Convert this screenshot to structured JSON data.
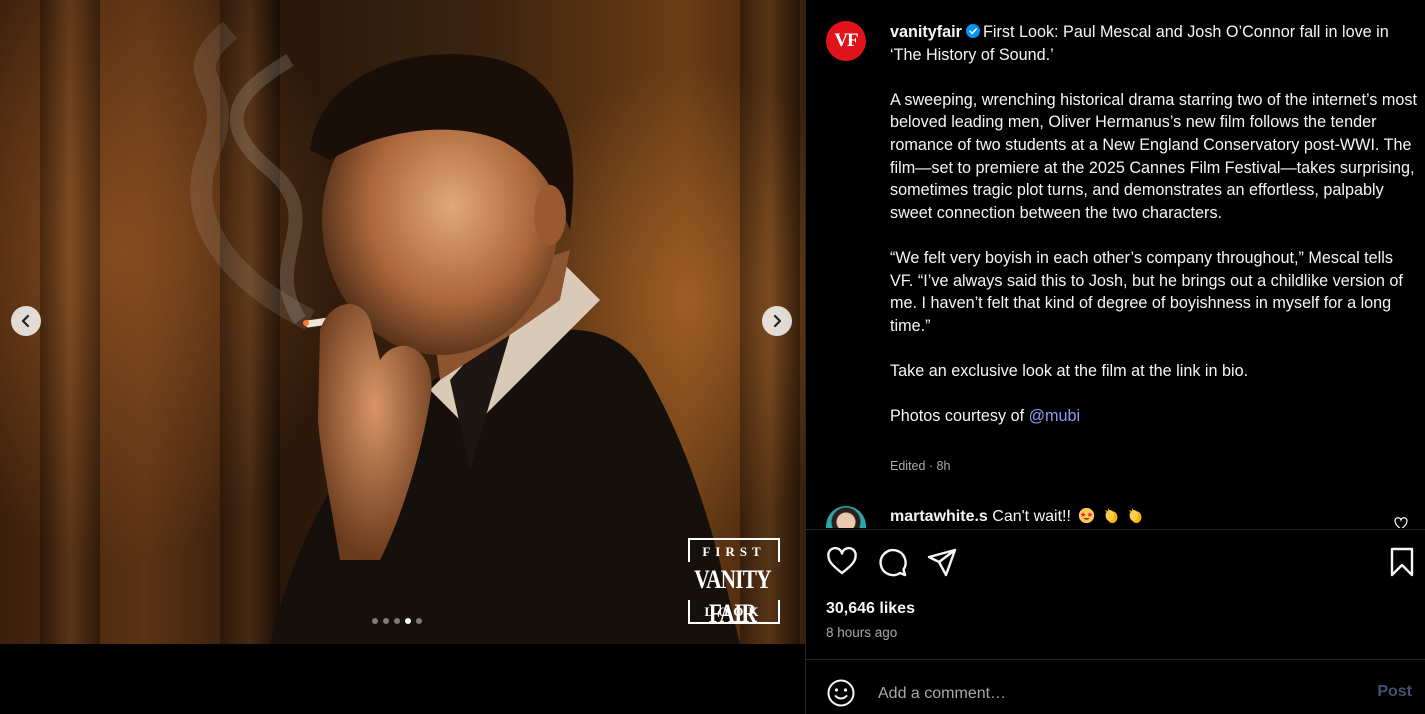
{
  "media": {
    "watermark": {
      "top": "FIRST",
      "middle": "VANITY FAIR",
      "bottom": "LOOK"
    },
    "carousel": {
      "total": 5,
      "active_index": 4
    },
    "prev_icon": "chevron-left-icon",
    "next_icon": "chevron-right-icon"
  },
  "post": {
    "avatar_text": "VF",
    "username": "vanityfair",
    "verified_icon": "verified-badge-icon",
    "caption_title": "First Look: Paul Mescal and Josh O’Connor fall in love in ‘The History of Sound.’",
    "caption_p1": "A sweeping, wrenching historical drama starring two of the internet’s most beloved leading men, Oliver Hermanus’s new film follows the tender romance of two students at a New England Conservatory post-WWI. The film—set to premiere at the 2025 Cannes Film Festival—takes surprising, sometimes tragic plot turns, and demonstrates an effortless, palpably sweet connection between the two characters.",
    "caption_p2": "“We felt very boyish in each other’s company throughout,” Mescal tells VF. “I’ve always said this to Josh, but he brings out a childlike version of me. I haven’t felt that kind of degree of boyishness in myself for a long time.”",
    "caption_p3": "Take an exclusive look at the film at the link in bio.",
    "caption_p4_prefix": "Photos courtesy of ",
    "caption_p4_mention": "@mubi",
    "edited_meta": "Edited · 8h"
  },
  "comment": {
    "username": "martawhite.s",
    "text": "Can't wait!!",
    "emojis": [
      "star-struck-emoji",
      "clapping-hands-emoji",
      "clapping-hands-emoji"
    ]
  },
  "actions": {
    "like_icon": "heart-icon",
    "comment_icon": "comment-icon",
    "share_icon": "send-icon",
    "save_icon": "bookmark-icon",
    "likes": "30,646 likes",
    "time": "8 hours ago"
  },
  "add_comment": {
    "emoji_icon": "smiley-icon",
    "placeholder": "Add a comment…",
    "post_label": "Post"
  },
  "colors": {
    "background": "#000000",
    "text": "#f5f5f5",
    "secondary_text": "#a8a8a8",
    "mention": "#8c9bf9",
    "brand_red": "#e0131a",
    "verified_blue": "#0095f6",
    "post_disabled": "#42506f"
  }
}
